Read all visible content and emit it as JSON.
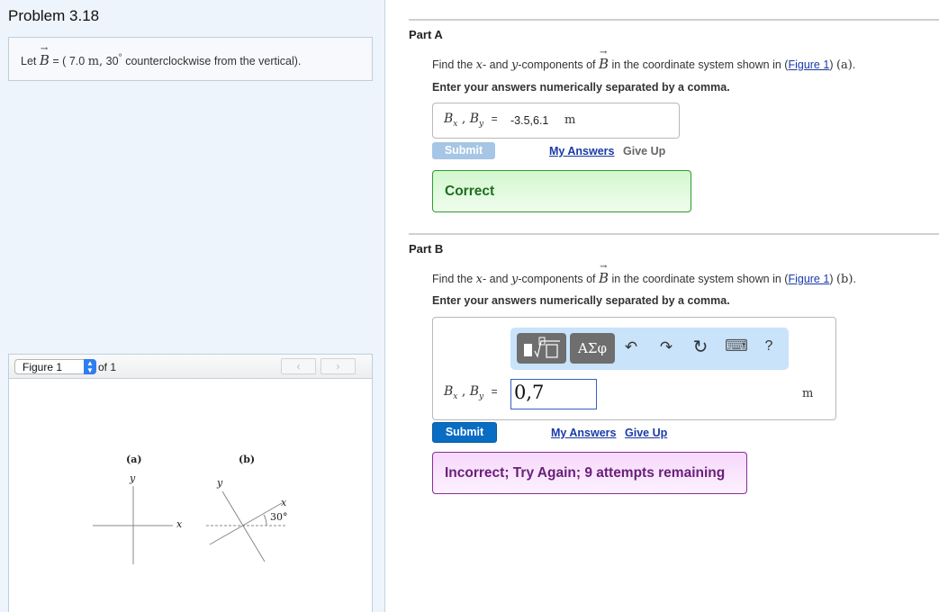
{
  "problem": {
    "title": "Problem 3.18",
    "statement": {
      "prefix": "Let",
      "vector": "B",
      "equals": "= (",
      "magnitude": "7.0",
      "unit": "m",
      "separator": ",",
      "angle": "30",
      "degree": "°",
      "suffix": "counterclockwise from the vertical)."
    }
  },
  "figure_panel": {
    "selected": "Figure 1",
    "of_label": "of 1",
    "prev_icon": "‹",
    "next_icon": "›",
    "labels": {
      "a": "(a)",
      "b": "(b)",
      "x": "x",
      "y": "y",
      "angle": "30°"
    }
  },
  "parts": [
    {
      "label": "Part A",
      "question": {
        "pre": "Find the",
        "x": "x",
        "mid1": "- and",
        "y": "y",
        "mid2": "-components of",
        "vector": "B",
        "mid3": "in the coordinate system shown in (",
        "link": "Figure 1",
        "post": ")",
        "which": "(a)",
        "end": "."
      },
      "instruction": "Enter your answers numerically separated by a comma.",
      "answer_label": {
        "b1": "B",
        "s1": "x",
        "comma": ",",
        "b2": "B",
        "s2": "y",
        "eq": "="
      },
      "answer_value": "-3.5,6.1",
      "unit": "m",
      "submit": "Submit",
      "my_answers": "My Answers",
      "give_up": "Give Up",
      "feedback": "Correct"
    },
    {
      "label": "Part B",
      "question": {
        "pre": "Find the",
        "x": "x",
        "mid1": "- and",
        "y": "y",
        "mid2": "-components of",
        "vector": "B",
        "mid3": "in the coordinate system shown in (",
        "link": "Figure 1",
        "post": ")",
        "which": "(b)",
        "end": "."
      },
      "instruction": "Enter your answers numerically separated by a comma.",
      "toolbar": {
        "greek": "ΑΣφ",
        "undo": "↶",
        "redo": "↷",
        "reset": "↻",
        "keyboard": "⌨",
        "help": "?"
      },
      "answer_label": {
        "b1": "B",
        "s1": "x",
        "comma": ",",
        "b2": "B",
        "s2": "y",
        "eq": "="
      },
      "answer_value": "0,7",
      "unit": "m",
      "submit": "Submit",
      "my_answers": "My Answers",
      "give_up": "Give Up",
      "feedback": "Incorrect; Try Again; 9 attempts remaining"
    }
  ]
}
